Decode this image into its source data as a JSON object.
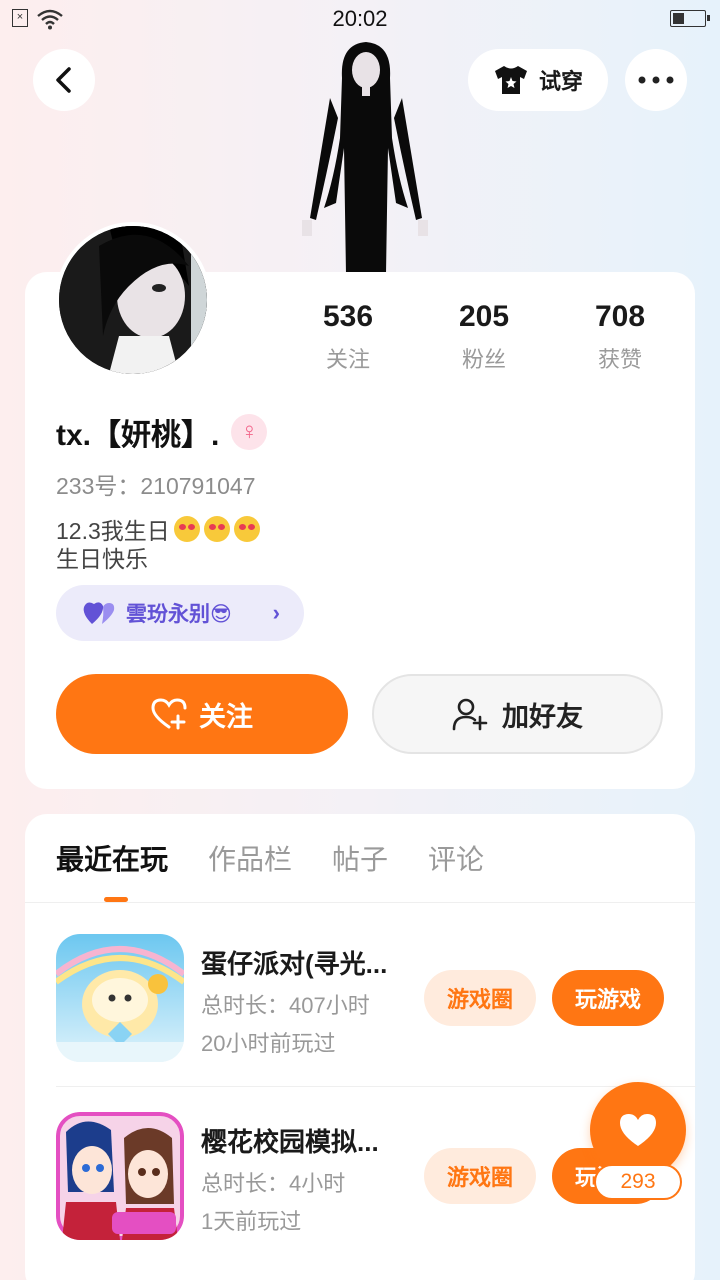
{
  "status_bar": {
    "time": "20:02",
    "battery_level": 0.35
  },
  "header": {
    "tryon_label": "试穿"
  },
  "profile": {
    "stats": [
      {
        "value": "536",
        "label": "关注"
      },
      {
        "value": "205",
        "label": "粉丝"
      },
      {
        "value": "708",
        "label": "获赞"
      }
    ],
    "username": "tx.【妍桃】.",
    "gender": "female",
    "id_text": "233号：210791047",
    "bio_line1": "12.3我生日",
    "bio_line2": "生日快乐",
    "group_name": "雲玢永别😎",
    "follow_label": "关注",
    "add_friend_label": "加好友"
  },
  "tabs": [
    {
      "label": "最近在玩",
      "active": true
    },
    {
      "label": "作品栏",
      "active": false
    },
    {
      "label": "帖子",
      "active": false
    },
    {
      "label": "评论",
      "active": false
    }
  ],
  "games": [
    {
      "title": "蛋仔派对(寻光...",
      "total_time": "总时长：407小时",
      "last_played": "20小时前玩过",
      "circle_label": "游戏圈",
      "play_label": "玩游戏"
    },
    {
      "title": "樱花校园模拟...",
      "total_time": "总时长：4小时",
      "last_played": "1天前玩过",
      "circle_label": "游戏圈",
      "play_label": "玩游戏"
    }
  ],
  "like": {
    "count": "293"
  },
  "colors": {
    "accent": "#ff7613",
    "group": "#6252d6",
    "gender": "#f2658a"
  }
}
